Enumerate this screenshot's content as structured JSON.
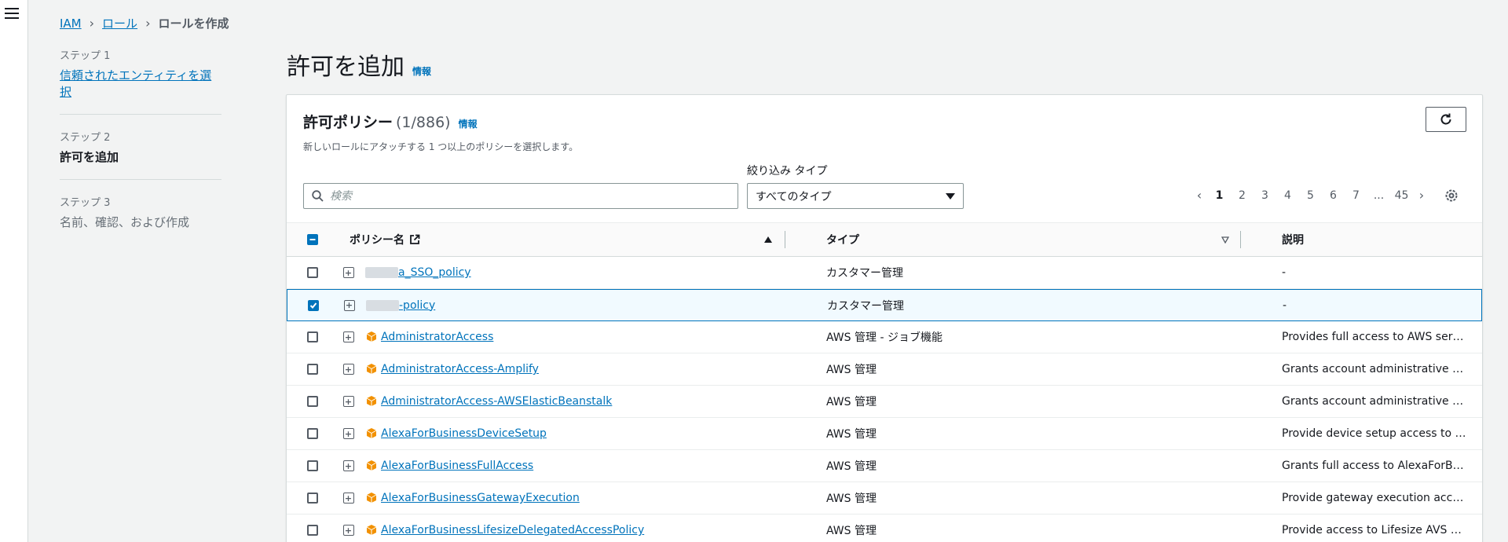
{
  "breadcrumb": [
    {
      "label": "IAM",
      "link": true
    },
    {
      "label": "ロール",
      "link": true
    },
    {
      "label": "ロールを作成",
      "link": false
    }
  ],
  "steps": [
    {
      "num": "ステップ 1",
      "label": "信頼されたエンティティを選択",
      "state": "link"
    },
    {
      "num": "ステップ 2",
      "label": "許可を追加",
      "state": "current"
    },
    {
      "num": "ステップ 3",
      "label": "名前、確認、および作成",
      "state": "pending"
    }
  ],
  "page": {
    "title": "許可を追加",
    "info": "情報"
  },
  "panel": {
    "title": "許可ポリシー",
    "count": "(1/886)",
    "info": "情報",
    "description": "新しいロールにアタッチする 1 つ以上のポリシーを選択します。"
  },
  "filter": {
    "label": "絞り込み タイプ",
    "search_placeholder": "検索",
    "type_selected": "すべてのタイプ"
  },
  "pagination": {
    "pages": [
      "1",
      "2",
      "3",
      "4",
      "5",
      "6",
      "7",
      "...",
      "45"
    ],
    "current": "1"
  },
  "table": {
    "headers": {
      "name": "ポリシー名",
      "type": "タイプ",
      "description": "説明"
    },
    "rows": [
      {
        "name": "a_SSO_policy",
        "masked": true,
        "aws": false,
        "type": "カスタマー管理",
        "description": "-",
        "checked": false
      },
      {
        "name": "-policy",
        "masked": true,
        "aws": false,
        "type": "カスタマー管理",
        "description": "-",
        "checked": true
      },
      {
        "name": "AdministratorAccess",
        "masked": false,
        "aws": true,
        "type": "AWS 管理 - ジョブ機能",
        "description": "Provides full access to AWS services an...",
        "checked": false
      },
      {
        "name": "AdministratorAccess-Amplify",
        "masked": false,
        "aws": true,
        "type": "AWS 管理",
        "description": "Grants account administrative permiss...",
        "checked": false
      },
      {
        "name": "AdministratorAccess-AWSElasticBeanstalk",
        "masked": false,
        "aws": true,
        "type": "AWS 管理",
        "description": "Grants account administrative permiss...",
        "checked": false
      },
      {
        "name": "AlexaForBusinessDeviceSetup",
        "masked": false,
        "aws": true,
        "type": "AWS 管理",
        "description": "Provide device setup access to AlexaFo...",
        "checked": false
      },
      {
        "name": "AlexaForBusinessFullAccess",
        "masked": false,
        "aws": true,
        "type": "AWS 管理",
        "description": "Grants full access to AlexaForBusiness ...",
        "checked": false
      },
      {
        "name": "AlexaForBusinessGatewayExecution",
        "masked": false,
        "aws": true,
        "type": "AWS 管理",
        "description": "Provide gateway execution access to A...",
        "checked": false
      },
      {
        "name": "AlexaForBusinessLifesizeDelegatedAccessPolicy",
        "masked": false,
        "aws": true,
        "type": "AWS 管理",
        "description": "Provide access to Lifesize AVS devices",
        "checked": false
      }
    ]
  },
  "icons": {
    "menu": "hamburger-icon",
    "search": "search-icon",
    "refresh": "refresh-icon",
    "external": "external-link-icon",
    "settings": "gear-icon",
    "aws_policy": "aws-cube-icon"
  },
  "colors": {
    "link": "#0073bb",
    "selected_border": "#0073bb",
    "aws_orange": "#f29100"
  }
}
